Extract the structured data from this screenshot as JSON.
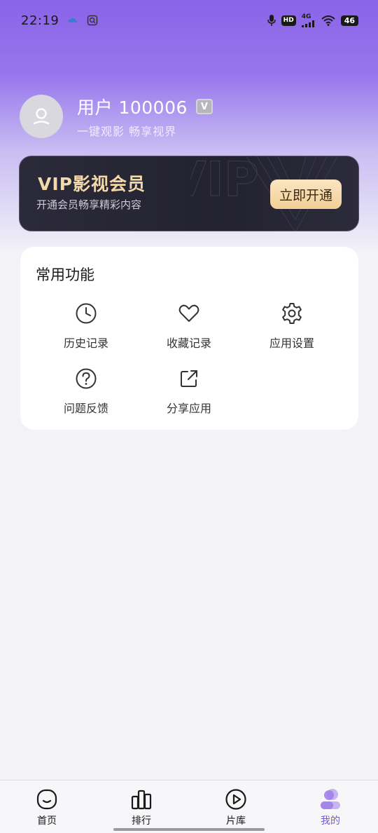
{
  "status_bar": {
    "time": "22:19",
    "network": "4G",
    "hd": "HD",
    "battery": "46"
  },
  "profile": {
    "username": "用户 100006",
    "badge": "V",
    "tagline": "一键观影 畅享视界"
  },
  "vip": {
    "title": "VIP影视会员",
    "subtitle": "开通会员畅享精彩内容",
    "button": "立即开通",
    "watermark": "VIP"
  },
  "functions": {
    "title": "常用功能",
    "items": [
      {
        "label": "历史记录",
        "icon": "clock-icon"
      },
      {
        "label": "收藏记录",
        "icon": "heart-icon"
      },
      {
        "label": "应用设置",
        "icon": "gear-icon"
      },
      {
        "label": "问题反馈",
        "icon": "help-icon"
      },
      {
        "label": "分享应用",
        "icon": "share-icon"
      }
    ]
  },
  "nav": {
    "items": [
      {
        "label": "首页",
        "icon": "home-icon"
      },
      {
        "label": "排行",
        "icon": "chart-icon"
      },
      {
        "label": "片库",
        "icon": "play-icon"
      },
      {
        "label": "我的",
        "icon": "profile-icon"
      }
    ],
    "active_color": "#7b55d6"
  },
  "colors": {
    "accent": "#8a63e8",
    "vip_gold": "#f4d9a8"
  }
}
